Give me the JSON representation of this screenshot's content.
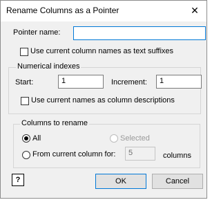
{
  "window": {
    "title": "Rename Columns as a Pointer",
    "close_symbol": "✕"
  },
  "pointer": {
    "label": "Pointer name:",
    "value": ""
  },
  "suffixes": {
    "label": "Use current column names as text suffixes",
    "checked": false
  },
  "numerical": {
    "group_label": "Numerical indexes",
    "start_label": "Start:",
    "start_value": "1",
    "increment_label": "Increment:",
    "increment_value": "1",
    "descriptions_label": "Use current names as column descriptions",
    "descriptions_checked": false
  },
  "rename": {
    "group_label": "Columns to rename",
    "all_label": "All",
    "selected_label": "Selected",
    "from_label": "From current column for:",
    "from_value": "5",
    "columns_label": "columns",
    "selected_option": "All"
  },
  "buttons": {
    "help_symbol": "?",
    "ok": "OK",
    "cancel": "Cancel"
  }
}
